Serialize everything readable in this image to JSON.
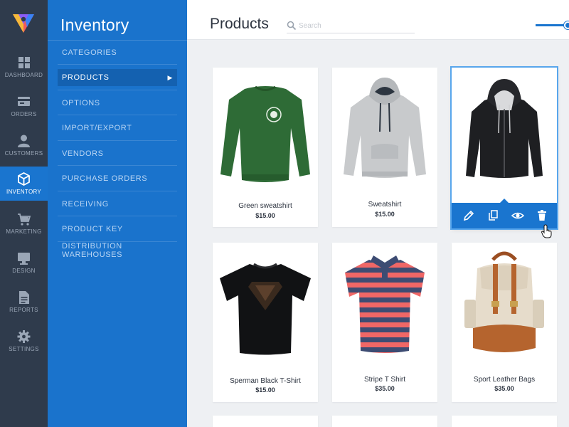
{
  "rail": {
    "items": [
      {
        "label": "Dashboard",
        "icon": "dashboard-icon"
      },
      {
        "label": "Orders",
        "icon": "card-icon"
      },
      {
        "label": "Customers",
        "icon": "user-icon"
      },
      {
        "label": "Inventory",
        "icon": "box-icon",
        "active": true
      },
      {
        "label": "Marketing",
        "icon": "cart-icon"
      },
      {
        "label": "Design",
        "icon": "monitor-icon"
      },
      {
        "label": "Reports",
        "icon": "document-icon"
      },
      {
        "label": "Settings",
        "icon": "gear-icon"
      }
    ]
  },
  "subnav": {
    "title": "Inventory",
    "items": [
      {
        "label": "Categories"
      },
      {
        "label": "Products",
        "active": true
      },
      {
        "label": "Options"
      },
      {
        "label": "Import/Export"
      },
      {
        "label": "Vendors"
      },
      {
        "label": "Purchase Orders"
      },
      {
        "label": "Receiving"
      },
      {
        "label": "Product Key Distribution"
      },
      {
        "label": "Warehouses"
      }
    ]
  },
  "header": {
    "title": "Products",
    "search_placeholder": "Search"
  },
  "products": [
    {
      "name": "Green sweatshirt",
      "price": "$15.00",
      "image": "green-sweatshirt"
    },
    {
      "name": "Sweatshirt",
      "price": "$15.00",
      "image": "grey-hoodie"
    },
    {
      "name": "",
      "price": "",
      "image": "black-zip-hoodie",
      "selected": true
    },
    {
      "name": "Sperman Black T-Shirt",
      "price": "$15.00",
      "image": "black-tshirt"
    },
    {
      "name": "Stripe T Shirt",
      "price": "$35.00",
      "image": "striped-polo"
    },
    {
      "name": "Sport Leather Bags",
      "price": "$35.00",
      "image": "leather-backpack"
    }
  ],
  "card_actions": [
    "edit-icon",
    "duplicate-icon",
    "view-icon",
    "trash-icon"
  ],
  "colors": {
    "rail_bg": "#2f3b4c",
    "accent": "#1a75cf",
    "subnav_bg": "#1a73cc",
    "subnav_active": "#1461b0",
    "content_bg": "#eef0f3"
  }
}
